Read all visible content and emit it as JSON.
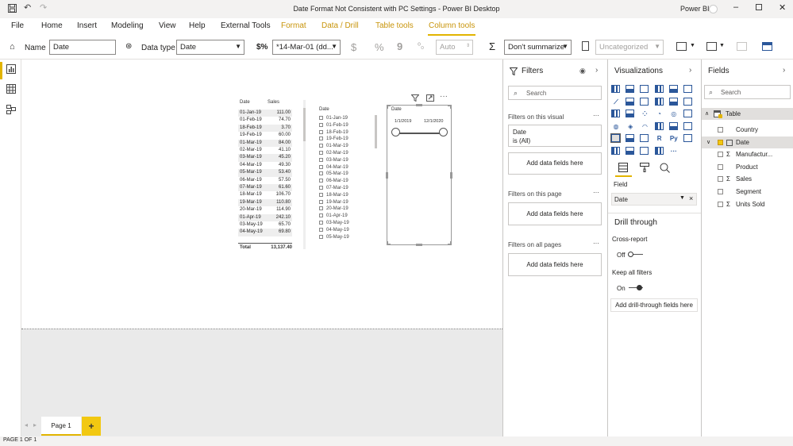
{
  "window": {
    "title": "Date Format Not Consistent with PC Settings - Power BI Desktop",
    "user": "Power BI"
  },
  "ribbon": {
    "tabs": [
      {
        "label": "File"
      },
      {
        "label": "Home"
      },
      {
        "label": "Insert"
      },
      {
        "label": "Modeling"
      },
      {
        "label": "View"
      },
      {
        "label": "Help"
      },
      {
        "label": "External Tools"
      },
      {
        "label": "Format"
      },
      {
        "label": "Data / Drill"
      },
      {
        "label": "Table tools"
      },
      {
        "label": "Column tools"
      }
    ],
    "active_tab": "Column tools",
    "accent_color": "#e2b400"
  },
  "toolbar": {
    "name_label": "Name",
    "name_value": "Date",
    "datatype_label": "Data type",
    "datatype_value": "Date",
    "format_value": "*14-Mar-01 (dd...",
    "currency_symbol": "$",
    "percent_symbol": "%",
    "comma_symbol": "9",
    "auto_value": "Auto",
    "summarize_value": "Don't summarize",
    "category_value": "Uncategorized"
  },
  "table_visual": {
    "headers": [
      "Date",
      "Sales"
    ],
    "rows": [
      [
        "01-Jan-19",
        "111.00"
      ],
      [
        "01-Feb-19",
        "74.70"
      ],
      [
        "18-Feb-19",
        "3.70"
      ],
      [
        "19-Feb-19",
        "60.00"
      ],
      [
        "01-Mar-19",
        "84.00"
      ],
      [
        "02-Mar-19",
        "41.10"
      ],
      [
        "03-Mar-19",
        "45.20"
      ],
      [
        "04-Mar-19",
        "49.30"
      ],
      [
        "05-Mar-19",
        "53.40"
      ],
      [
        "06-Mar-19",
        "57.50"
      ],
      [
        "07-Mar-19",
        "61.60"
      ],
      [
        "18-Mar-19",
        "106.70"
      ],
      [
        "19-Mar-19",
        "110.80"
      ],
      [
        "20-Mar-19",
        "114.90"
      ],
      [
        "01-Apr-19",
        "242.10"
      ],
      [
        "03-May-19",
        "65.70"
      ],
      [
        "04-May-19",
        "69.80"
      ]
    ],
    "total_label": "Total",
    "total_value": "13,137.40"
  },
  "slicer_list": {
    "header": "Date",
    "items": [
      "01-Jan-19",
      "01-Feb-19",
      "18-Feb-19",
      "19-Feb-19",
      "01-Mar-19",
      "02-Mar-19",
      "03-Mar-19",
      "04-Mar-19",
      "05-Mar-19",
      "06-Mar-19",
      "07-Mar-19",
      "18-Mar-19",
      "19-Mar-19",
      "20-Mar-19",
      "01-Apr-19",
      "03-May-19",
      "04-May-19",
      "05-May-19"
    ]
  },
  "slicer_range": {
    "header": "Date",
    "start": "1/1/2019",
    "end": "12/1/2020"
  },
  "filters": {
    "title": "Filters",
    "search_placeholder": "Search",
    "on_visual": "Filters on this visual",
    "visual_filter_field": "Date",
    "visual_filter_state": "is (All)",
    "add_fields": "Add data fields here",
    "on_page": "Filters on this page",
    "on_all_pages": "Filters on all pages"
  },
  "visualizations": {
    "title": "Visualizations",
    "field_label": "Field",
    "field_value": "Date",
    "drill_title": "Drill through",
    "cross_report": "Cross-report",
    "cross_report_state": "Off",
    "keep_filters": "Keep all filters",
    "keep_filters_state": "On",
    "add_drill": "Add drill-through fields here"
  },
  "fields": {
    "title": "Fields",
    "search_placeholder": "Search",
    "table_name": "Table",
    "items": [
      {
        "label": "Country",
        "sigma": false,
        "checked": false
      },
      {
        "label": "Date",
        "sigma": false,
        "checked": true
      },
      {
        "label": "Manufactur...",
        "sigma": true,
        "checked": false
      },
      {
        "label": "Product",
        "sigma": false,
        "checked": false
      },
      {
        "label": "Sales",
        "sigma": true,
        "checked": false
      },
      {
        "label": "Segment",
        "sigma": false,
        "checked": false
      },
      {
        "label": "Units Sold",
        "sigma": true,
        "checked": false
      }
    ]
  },
  "pages": {
    "tabs": [
      "Page 1"
    ],
    "add_symbol": "+"
  },
  "status": {
    "text": "PAGE 1 OF 1"
  }
}
